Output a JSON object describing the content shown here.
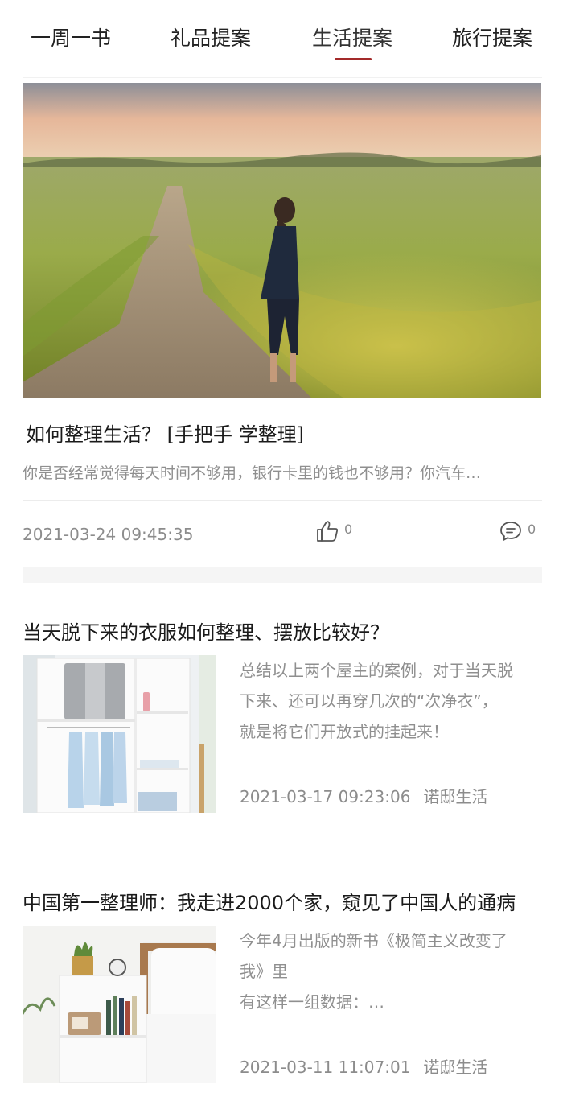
{
  "tabs": [
    {
      "label": "一周一书",
      "active": false
    },
    {
      "label": "礼品提案",
      "active": false
    },
    {
      "label": "生活提案",
      "active": true
    },
    {
      "label": "旅行提案",
      "active": false
    }
  ],
  "accent_color": "#a32a2a",
  "featured": {
    "title": "如何整理生活？ [手把手 学整理]",
    "summary": "你是否经常觉得每天时间不够用，银行卡里的钱也不够用？你汽车…",
    "time": "2021-03-24 09:45:35",
    "likes": "0",
    "comments": "0",
    "like_icon": "thumbs-up-icon",
    "comment_icon": "comment-bubble-icon"
  },
  "articles": [
    {
      "title": "当天脱下来的衣服如何整理、摆放比较好？",
      "summary_lines": [
        "总结以上两个屋主的案例，对于当天脱",
        "下来、还可以再穿几次的“次净衣”，",
        "就是将它们开放式的挂起来！"
      ],
      "time": "2021-03-17 09:23:06",
      "source": "诺邸生活"
    },
    {
      "title": "中国第一整理师：我走进2000个家，窥见了中国人的通病",
      "summary_lines": [
        "今年4月出版的新书《极简主义改变了",
        "我》里",
        "有这样一组数据：…"
      ],
      "time": "2021-03-11 11:07:01",
      "source": "诺邸生活"
    }
  ]
}
